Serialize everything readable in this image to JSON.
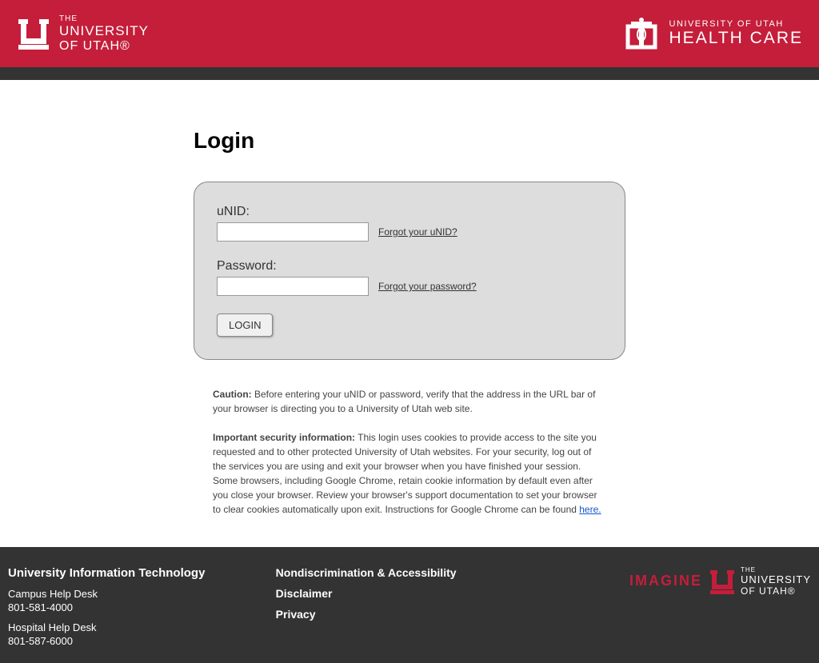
{
  "header": {
    "left_logo": {
      "the": "THE",
      "univ": "UNIVERSITY",
      "utah": "OF UTAH®"
    },
    "right_logo": {
      "uou": "UNIVERSITY OF UTAH",
      "hc": "HEALTH CARE"
    }
  },
  "main": {
    "title": "Login",
    "unid": {
      "label": "uNID:",
      "forgot": "Forgot your uNID?",
      "value": ""
    },
    "password": {
      "label": "Password:",
      "forgot": "Forgot your password?",
      "value": ""
    },
    "login_button": "LOGIN",
    "caution_label": "Caution:",
    "caution_text": " Before entering your uNID or password, verify that the address in the URL bar of your browser is directing you to a University of Utah web site.",
    "security_label": "Important security information:",
    "security_text": " This login uses cookies to provide access to the site you requested and to other protected University of Utah websites. For your security, log out of the services you are using and exit your browser when you have finished your session. Some browsers, including Google Chrome, retain cookie information by default even after you close your browser. Review your browser's support documentation to set your browser to clear cookies automatically upon exit. Instructions for Google Chrome can be found ",
    "security_link": "here."
  },
  "footer": {
    "col1": {
      "heading": "University Information Technology",
      "campus_label": "Campus Help Desk",
      "campus_phone": "801-581-4000",
      "hospital_label": "Hospital Help Desk",
      "hospital_phone": "801-587-6000"
    },
    "col2": {
      "link1": "Nondiscrimination & Accessibility",
      "link2": "Disclaimer",
      "link3": "Privacy"
    },
    "col3": {
      "imagine": "IMAGINE",
      "the": "THE",
      "univ": "UNIVERSITY",
      "utah": "OF UTAH®"
    }
  }
}
